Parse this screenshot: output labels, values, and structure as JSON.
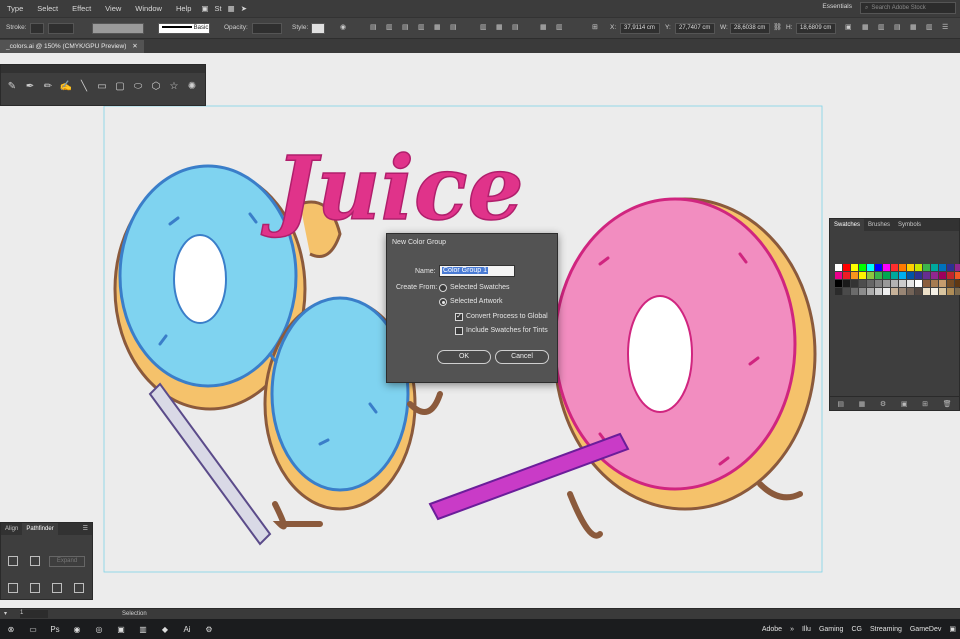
{
  "menubar": {
    "items": [
      "Type",
      "Select",
      "Effect",
      "View",
      "Window",
      "Help"
    ],
    "workspace": "Essentials",
    "stock_search_placeholder": "Search Adobe Stock"
  },
  "control": {
    "stroke_label": "Stroke:",
    "brush_label": "Basic",
    "opacity_label": "Opacity:",
    "style_label": "Style:",
    "x_value": "37,9114 cm",
    "y_value": "27,7407 cm",
    "w_value": "28,6038 cm",
    "h_value": "18,6809 cm",
    "x_label": "X:",
    "y_label": "Y:",
    "w_label": "W:",
    "h_label": "H:"
  },
  "document": {
    "tab_title": "_colors.ai @ 150% (CMYK/GPU Preview)",
    "art_text": "Juice"
  },
  "dialog": {
    "title": "New Color Group",
    "name_label": "Name:",
    "name_value": "Color Group 1",
    "create_from_label": "Create From:",
    "option_selected_swatches": "Selected Swatches",
    "option_selected_artwork": "Selected Artwork",
    "checkbox_convert": "Convert Process to Global",
    "checkbox_include": "Include Swatches for Tints",
    "ok_label": "OK",
    "cancel_label": "Cancel"
  },
  "swatches_panel": {
    "tabs": [
      "Swatches",
      "Brushes",
      "Symbols"
    ],
    "colors": [
      "#ffffff",
      "#ff0000",
      "#ffff00",
      "#00ff00",
      "#00ffff",
      "#0000ff",
      "#ff00ff",
      "#ff2e2e",
      "#ff7a00",
      "#ffd000",
      "#c8e600",
      "#3cb44b",
      "#00a99d",
      "#0072bc",
      "#2e3192",
      "#92278f",
      "#ec008c",
      "#ed1c24",
      "#f7941d",
      "#fff200",
      "#8dc63f",
      "#39b54a",
      "#00a651",
      "#00a99d",
      "#00aeef",
      "#0054a6",
      "#2e3192",
      "#662d91",
      "#92278f",
      "#9e005d",
      "#c1272d",
      "#f15a24",
      "#000000",
      "#1a1a1a",
      "#333333",
      "#4d4d4d",
      "#666666",
      "#808080",
      "#999999",
      "#b3b3b3",
      "#cccccc",
      "#e6e6e6",
      "#ffffff",
      "#8b5e3c",
      "#a67c52",
      "#c69c6d",
      "#754c24",
      "#603813",
      "#2b2b2b",
      "#4a4a4a",
      "#6b6b6b",
      "#8c8c8c",
      "#adadad",
      "#cecece",
      "#efefef",
      "#c7b299",
      "#998675",
      "#736357",
      "#534741",
      "#ede0c8",
      "#f5f0e6",
      "#d9c5a0",
      "#b08d57",
      "#7d6b4f"
    ]
  },
  "pathfinder_panel": {
    "tabs": [
      "Align",
      "Pathfinder"
    ],
    "expand_label": "Expand"
  },
  "statusbar": {
    "zoom_value": "1",
    "selection_label": "Selection"
  },
  "taskbar": {
    "items": [
      "Adobe",
      "Illu",
      "Gaming",
      "CG",
      "Streaming",
      "GameDev"
    ],
    "chevron": "»"
  }
}
